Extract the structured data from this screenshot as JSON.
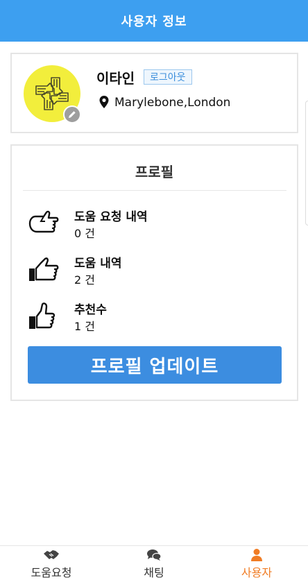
{
  "header": {
    "title": "사용자 정보"
  },
  "user": {
    "name": "이타인",
    "logout_label": "로그아웃",
    "location": "Marylebone,London"
  },
  "profile": {
    "title": "프로필",
    "stats": [
      {
        "label": "도움 요청 내역",
        "count": "0 건",
        "icon": "thumb-pointing-icon"
      },
      {
        "label": "도움 내역",
        "count": "2 건",
        "icon": "thumb-right-icon"
      },
      {
        "label": "추천수",
        "count": "1 건",
        "icon": "thumbs-up-icon"
      }
    ],
    "update_label": "프로필 업데이트"
  },
  "bottom_nav": {
    "items": [
      {
        "label": "도움요청",
        "icon": "handshake-icon"
      },
      {
        "label": "채팅",
        "icon": "chat-icon"
      },
      {
        "label": "사용자",
        "icon": "user-icon",
        "active": true
      }
    ]
  },
  "colors": {
    "accent": "#3d9ff0",
    "button": "#3c8de0",
    "active_nav": "#f07c24",
    "avatar_bg": "#f2ee3c"
  }
}
